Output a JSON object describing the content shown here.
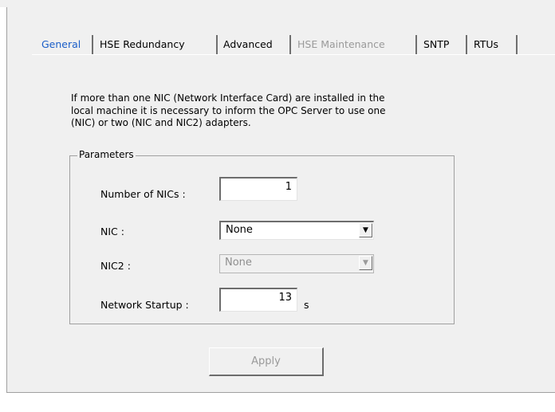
{
  "tabs": [
    {
      "label": "General",
      "state": "selected"
    },
    {
      "label": "HSE Redundancy",
      "state": "normal"
    },
    {
      "label": "Advanced",
      "state": "normal"
    },
    {
      "label": "HSE Maintenance",
      "state": "disabled"
    },
    {
      "label": "SNTP",
      "state": "normal"
    },
    {
      "label": "RTUs",
      "state": "normal"
    }
  ],
  "description": {
    "line1": "If more than one NIC (Network Interface Card) are installed in the",
    "line2": "local machine it is necessary to inform the OPC Server to use one",
    "line3": "(NIC) or two (NIC and NIC2) adapters."
  },
  "parameters": {
    "group_label": "Parameters",
    "num_nics": {
      "label": "Number of NICs :",
      "value": "1"
    },
    "nic": {
      "label": "NIC :",
      "value": "None",
      "enabled": true
    },
    "nic2": {
      "label": "NIC2 :",
      "value": "None",
      "enabled": false
    },
    "network_startup": {
      "label": "Network Startup :",
      "value": "13",
      "unit": "s"
    }
  },
  "apply_button": {
    "label": "Apply",
    "enabled": false
  },
  "colors": {
    "selected_tab": "#1a5ec8",
    "disabled_text": "#9a9a9a",
    "dialog_bg": "#f0f0f0"
  },
  "icons": {
    "dropdown": "chevron-down-icon"
  }
}
